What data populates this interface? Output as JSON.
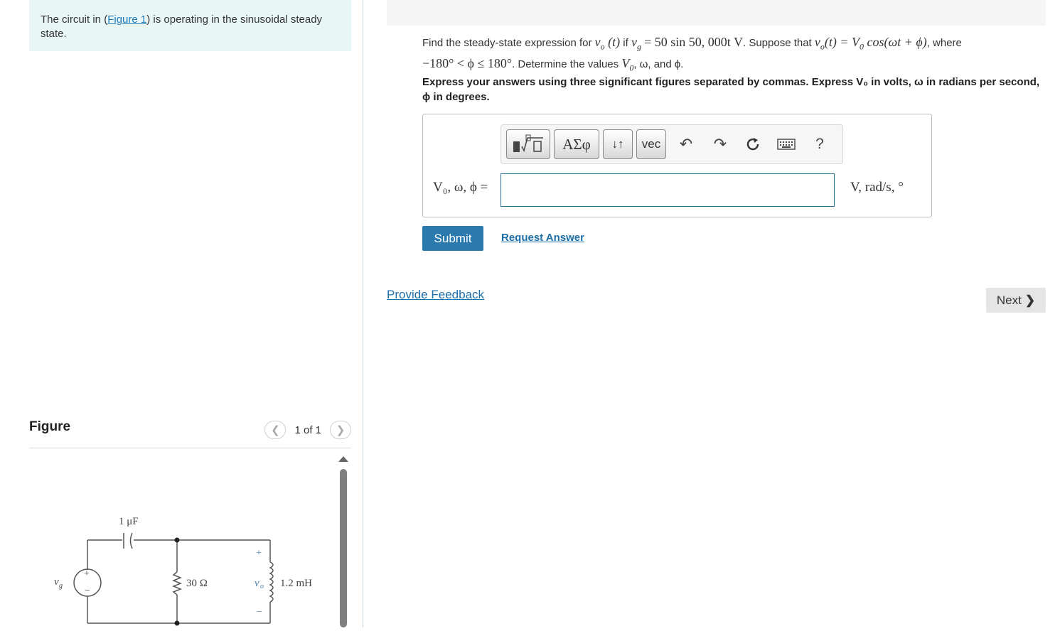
{
  "intro": {
    "text_before": "The circuit in (",
    "link": "Figure 1",
    "text_after": ") is operating in the sinusoidal steady state."
  },
  "figure": {
    "title": "Figure",
    "pager": "1 of 1",
    "circuit": {
      "capacitor": "1 μF",
      "source": "v",
      "source_sub": "g",
      "resistor": "30 Ω",
      "output": "v",
      "output_sub": "o",
      "inductor": "1.2 mH",
      "plus": "+",
      "minus": "−"
    }
  },
  "question": {
    "p1": "Find the steady-state expression for ",
    "p2": " if ",
    "vg_expr": "= 50 sin 50, 000t V",
    "p3": ". Suppose that ",
    "vo_expr": "v",
    "p4": ", where",
    "range": "−180° < ϕ ≤ 180°",
    "p5": ". Determine the values ",
    "vals": "V",
    "p6": ", ω, and ϕ."
  },
  "instructions": "Express your answers using three significant figures separated by commas. Express V₀ in volts, ω in radians per second, ϕ in degrees.",
  "toolbar": {
    "greek": "ΑΣφ",
    "arrows": "↓↑",
    "vec": "vec",
    "help": "?"
  },
  "answer": {
    "label": "V₀, ω, ϕ =",
    "value": "",
    "units": "V, rad/s, °"
  },
  "actions": {
    "submit": "Submit",
    "request": "Request Answer",
    "feedback": "Provide Feedback",
    "next": "Next"
  },
  "colors": {
    "accent": "#2a7ab0",
    "intro_bg": "#e8f6f6",
    "link": "#1f6fa8"
  }
}
